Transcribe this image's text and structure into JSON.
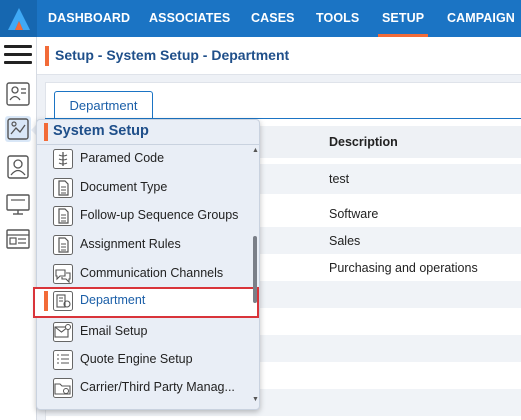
{
  "nav": {
    "items": [
      "DASHBOARD",
      "ASSOCIATES",
      "CASES",
      "TOOLS",
      "SETUP",
      "CAMPAIGN"
    ],
    "active": "SETUP"
  },
  "breadcrumb": "Setup - System Setup - Department",
  "tab": {
    "label": "Department"
  },
  "table": {
    "header": "Description",
    "rows": [
      "test",
      "Software",
      "Sales",
      "Purchasing and operations"
    ]
  },
  "flyout": {
    "title": "System Setup",
    "items": [
      {
        "label": "Paramed Code",
        "icon": "caduceus-icon"
      },
      {
        "label": "Document Type",
        "icon": "document-icon"
      },
      {
        "label": "Follow-up Sequence Groups",
        "icon": "document-icon"
      },
      {
        "label": "Assignment Rules",
        "icon": "document-icon"
      },
      {
        "label": "Communication Channels",
        "icon": "chat-icon"
      },
      {
        "label": "Department",
        "icon": "department-icon",
        "selected": true
      },
      {
        "label": "Email Setup",
        "icon": "envelope-gear-icon"
      },
      {
        "label": "Quote Engine Setup",
        "icon": "list-icon"
      },
      {
        "label": "Carrier/Third Party Manag...",
        "icon": "folder-gear-icon"
      }
    ]
  },
  "colors": {
    "nav_bg": "#1b74c4",
    "accent": "#f26b38",
    "selection_border": "#d9343a",
    "title_blue": "#1f4f8a"
  }
}
